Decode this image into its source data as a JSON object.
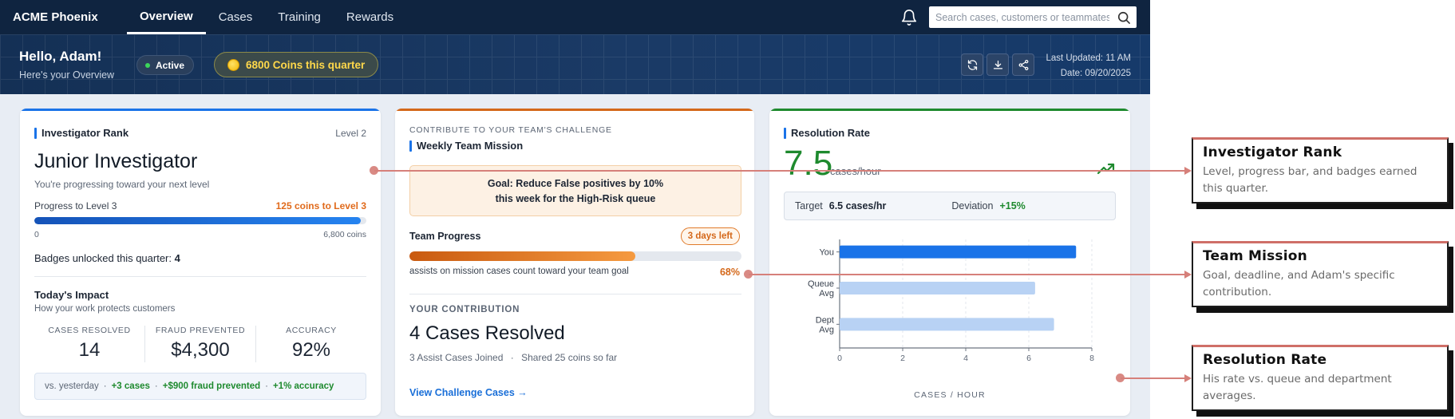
{
  "app": {
    "brand": "ACME Phoenix",
    "nav_tabs": [
      {
        "label": "Overview",
        "active": true
      },
      {
        "label": "Cases",
        "active": false
      },
      {
        "label": "Training",
        "active": false
      },
      {
        "label": "Rewards",
        "active": false
      }
    ],
    "search_placeholder": "Search cases, customers or teammates",
    "icons": {
      "notifications": "bell-icon",
      "search": "search-icon",
      "refresh": "refresh-icon",
      "download": "download-icon",
      "share": "share-icon"
    }
  },
  "header": {
    "greeting": "Hello, Adam!",
    "subtitle": "Here's your Overview",
    "status": "Active",
    "coins": "6800 Coins this quarter",
    "last_updated": "Last Updated: 11 AM",
    "date": "Date: 09/20/2025"
  },
  "rank_card": {
    "title": "Investigator Rank",
    "level": "Level 2",
    "rank": "Junior Investigator",
    "rank_sub": "You're progressing toward your next level",
    "progress_label": "Progress to Level 3",
    "progress_remaining": "125 coins to Level 3",
    "progress_fraction": 0.982,
    "progress_min": "0",
    "progress_max": "6,800 coins",
    "badges_label": "Badges unlocked this quarter:",
    "badges_count": "4",
    "impact_title": "Today's Impact",
    "impact_sub": "How your work protects customers",
    "stats": [
      {
        "label": "CASES RESOLVED",
        "value": "14"
      },
      {
        "label": "FRAUD PREVENTED",
        "value": "$4,300"
      },
      {
        "label": "ACCURACY",
        "value": "92%"
      }
    ],
    "compare_prefix": "vs. yesterday",
    "compare_items": [
      "+3 cases",
      "+$900 fraud prevented",
      "+1% accuracy"
    ],
    "accent": "#1a73e8"
  },
  "mission_card": {
    "eyebrow": "CONTRIBUTE TO YOUR TEAM'S CHALLENGE",
    "title": "Weekly Team Mission",
    "goal_line1": "Goal: Reduce False positives by 10%",
    "goal_line2": "this week for the High-Risk queue",
    "team_progress_label": "Team Progress",
    "days_left": "3 days left",
    "progress_fraction": 0.68,
    "progress_note": "assists on mission cases count toward your team goal",
    "progress_percent": "68%",
    "contribution_label": "YOUR CONTRIBUTION",
    "cases_resolved": "4 Cases Resolved",
    "assist_joined": "3 Assist Cases Joined",
    "coins_shared": "Shared 25 coins so far",
    "cta": "View Challenge Cases →",
    "accent": "#d4681a"
  },
  "resolution_card": {
    "title": "Resolution Rate",
    "rate": "7.5",
    "unit": "cases/hour",
    "trend_icon": "trending-up-icon",
    "target_label": "Target",
    "target_value": "6.5 cases/hr",
    "deviation_label": "Deviation",
    "deviation_value": "+15%",
    "accent": "#1e8a2e"
  },
  "chart_data": {
    "type": "bar",
    "orientation": "horizontal",
    "categories": [
      "You",
      "Queue Avg",
      "Dept Avg"
    ],
    "values": [
      7.5,
      6.2,
      6.8
    ],
    "xlabel": "CASES / HOUR",
    "xlim": [
      0,
      8
    ],
    "xticks": [
      "0",
      "2",
      "4",
      "6",
      "8"
    ],
    "grid": true,
    "colors": [
      "#1a73e8",
      "#b8d2f4",
      "#b8d2f4"
    ]
  },
  "callouts": [
    {
      "title": "Investigator Rank",
      "text": "Level, progress bar, and badges earned this quarter."
    },
    {
      "title": "Team Mission",
      "text": "Goal, deadline, and Adam's specific contribution."
    },
    {
      "title": "Resolution Rate",
      "text": "His rate vs. queue and department averages."
    }
  ]
}
